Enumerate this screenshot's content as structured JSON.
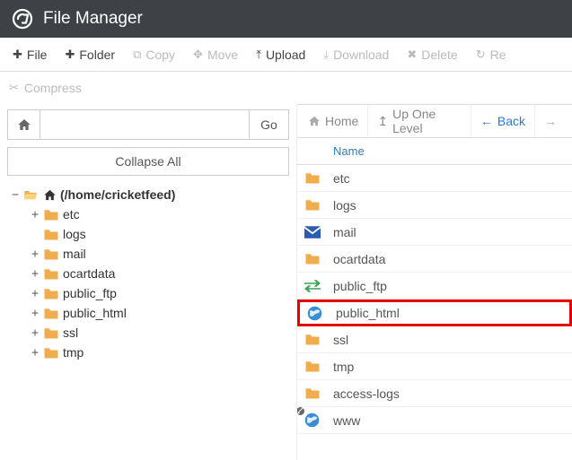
{
  "header": {
    "title": "File Manager"
  },
  "toolbar": {
    "file": "File",
    "folder": "Folder",
    "copy": "Copy",
    "move": "Move",
    "upload": "Upload",
    "download": "Download",
    "delete": "Delete",
    "restore": "Re"
  },
  "toolbar2": {
    "compress": "Compress"
  },
  "goto": {
    "button": "Go",
    "value": ""
  },
  "collapse": "Collapse All",
  "tree": {
    "root": "(/home/cricketfeed)",
    "items": [
      {
        "name": "etc",
        "expandable": true
      },
      {
        "name": "logs",
        "expandable": false
      },
      {
        "name": "mail",
        "expandable": true
      },
      {
        "name": "ocartdata",
        "expandable": true
      },
      {
        "name": "public_ftp",
        "expandable": true
      },
      {
        "name": "public_html",
        "expandable": true
      },
      {
        "name": "ssl",
        "expandable": true
      },
      {
        "name": "tmp",
        "expandable": true
      }
    ]
  },
  "nav": {
    "home": "Home",
    "up": "Up One Level",
    "back": "Back"
  },
  "columns": {
    "name": "Name"
  },
  "files": [
    {
      "name": "etc",
      "icon": "folder"
    },
    {
      "name": "logs",
      "icon": "folder"
    },
    {
      "name": "mail",
      "icon": "mail"
    },
    {
      "name": "ocartdata",
      "icon": "folder"
    },
    {
      "name": "public_ftp",
      "icon": "arrows"
    },
    {
      "name": "public_html",
      "icon": "globe",
      "highlight": true
    },
    {
      "name": "ssl",
      "icon": "folder"
    },
    {
      "name": "tmp",
      "icon": "folder"
    },
    {
      "name": "access-logs",
      "icon": "folder-link"
    },
    {
      "name": "www",
      "icon": "globe-link"
    }
  ]
}
